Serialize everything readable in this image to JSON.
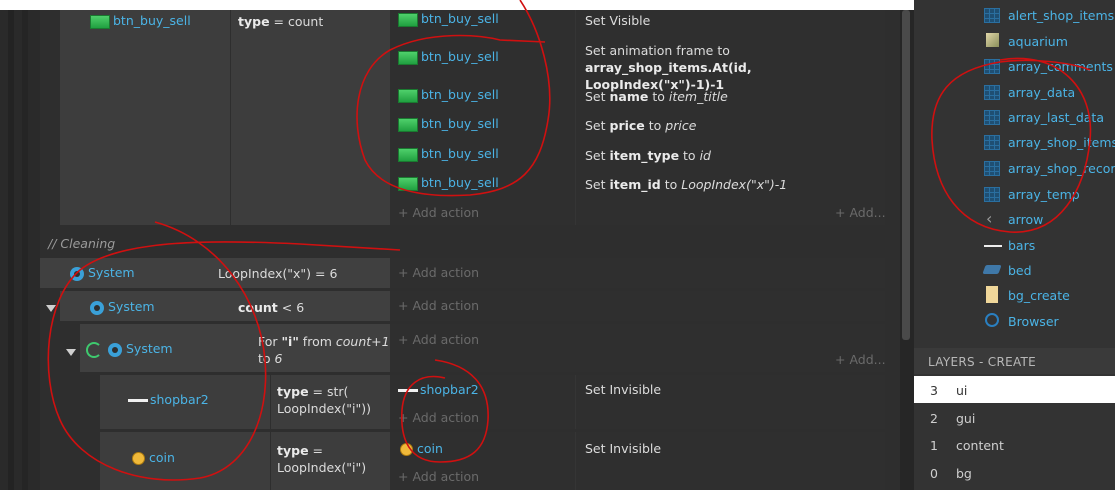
{
  "events": {
    "top_condition": {
      "object": "btn_buy_sell",
      "expr_key": "type",
      "expr_rest": " = count"
    },
    "top_actions": [
      {
        "object": "btn_buy_sell",
        "action": "Set Visible"
      },
      {
        "object": "btn_buy_sell",
        "action_prefix": "Set animation frame to ",
        "action_bold": "array_shop_items.At(id, LoopIndex(\"x\")-1)-1"
      },
      {
        "object": "btn_buy_sell",
        "action_prefix": "Set ",
        "action_bold": "name",
        "action_mid": " to ",
        "action_ital": "item_title"
      },
      {
        "object": "btn_buy_sell",
        "action_prefix": "Set ",
        "action_bold": "price",
        "action_mid": " to ",
        "action_ital": "price"
      },
      {
        "object": "btn_buy_sell",
        "action_prefix": "Set ",
        "action_bold": "item_type",
        "action_mid": " to ",
        "action_ital": "id"
      },
      {
        "object": "btn_buy_sell",
        "action_prefix": "Set ",
        "action_bold": "item_id",
        "action_mid": " to ",
        "action_ital": "LoopIndex(\"x\")-1"
      }
    ],
    "add_action": "+ Add action",
    "add_short": "+ Add...",
    "comment": "//  Cleaning",
    "sys1": {
      "object": "System",
      "condition": "LoopIndex(\"x\") = 6"
    },
    "sys2": {
      "object": "System",
      "cond_bold": "count",
      "cond_rest": " < 6"
    },
    "sys3": {
      "object": "System",
      "cond_prefix": "For ",
      "cond_bold": "\"i\"",
      "cond_mid": " from ",
      "cond_ital": "count+1",
      "cond_line2_pre": "to ",
      "cond_line2_ital": "6"
    },
    "shopbar": {
      "object": "shopbar2",
      "cond_bold": "type",
      "cond_rest": " = str(",
      "cond_line2": "LoopIndex(\"i\"))",
      "action_object": "shopbar2",
      "action": "Set Invisible"
    },
    "coin": {
      "object": "coin",
      "cond_bold": "type",
      "cond_rest": " =",
      "cond_line2": "LoopIndex(\"i\")",
      "action_object": "coin",
      "action": "Set Invisible"
    }
  },
  "project": {
    "items": [
      {
        "label": "alert_shop_items",
        "icon": "grid-icon"
      },
      {
        "label": "aquarium",
        "icon": "box-icon"
      },
      {
        "label": "array_comments",
        "icon": "grid-icon"
      },
      {
        "label": "array_data",
        "icon": "grid-icon"
      },
      {
        "label": "array_last_data",
        "icon": "grid-icon"
      },
      {
        "label": "array_shop_items",
        "icon": "grid-icon"
      },
      {
        "label": "array_shop_record",
        "icon": "grid-icon"
      },
      {
        "label": "array_temp",
        "icon": "grid-icon"
      },
      {
        "label": "arrow",
        "icon": "arrow-icon"
      },
      {
        "label": "bars",
        "icon": "bar-icon"
      },
      {
        "label": "bed",
        "icon": "bed-icon"
      },
      {
        "label": "bg_create",
        "icon": "rect-icon"
      },
      {
        "label": "Browser",
        "icon": "globe-icon"
      }
    ]
  },
  "layers": {
    "title": "LAYERS - CREATE",
    "rows": [
      {
        "num": "3",
        "name": "ui",
        "selected": true
      },
      {
        "num": "2",
        "name": "gui"
      },
      {
        "num": "1",
        "name": "content"
      },
      {
        "num": "0",
        "name": "bg"
      }
    ]
  },
  "colors": {
    "accent": "#4bb4e6",
    "annotation": "#d01010",
    "selected_layer": "#ffffff"
  }
}
